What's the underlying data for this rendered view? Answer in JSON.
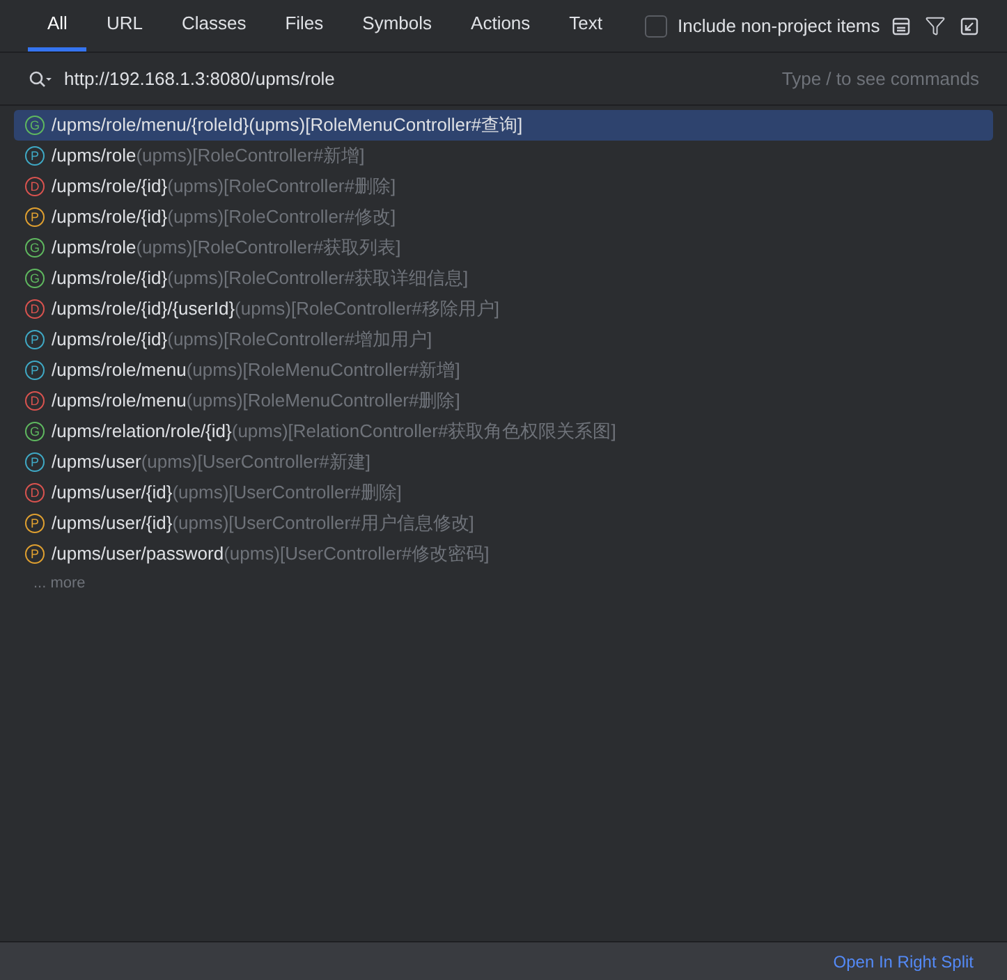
{
  "tabs": [
    {
      "label": "All",
      "selected": true
    },
    {
      "label": "URL",
      "selected": false
    },
    {
      "label": "Classes",
      "selected": false
    },
    {
      "label": "Files",
      "selected": false
    },
    {
      "label": "Symbols",
      "selected": false
    },
    {
      "label": "Actions",
      "selected": false
    },
    {
      "label": "Text",
      "selected": false
    }
  ],
  "include_non_project": {
    "label": "Include non-project items",
    "checked": false
  },
  "search": {
    "value": "http://192.168.1.3:8080/upms/role",
    "hint": "Type / to see commands"
  },
  "results": [
    {
      "badge": "G",
      "color": "#5fb85f",
      "path": "/upms/role/menu/{roleId}",
      "detail": "(upms)[RoleMenuController#查询]",
      "selected": true
    },
    {
      "badge": "P",
      "color": "#3fa9c5",
      "path": "/upms/role",
      "detail": "(upms)[RoleController#新增]",
      "selected": false
    },
    {
      "badge": "D",
      "color": "#d9534f",
      "path": "/upms/role/{id}",
      "detail": "(upms)[RoleController#删除]",
      "selected": false
    },
    {
      "badge": "P",
      "color": "#e0a030",
      "path": "/upms/role/{id}",
      "detail": "(upms)[RoleController#修改]",
      "selected": false
    },
    {
      "badge": "G",
      "color": "#5fb85f",
      "path": "/upms/role",
      "detail": "(upms)[RoleController#获取列表]",
      "selected": false
    },
    {
      "badge": "G",
      "color": "#5fb85f",
      "path": "/upms/role/{id}",
      "detail": "(upms)[RoleController#获取详细信息]",
      "selected": false
    },
    {
      "badge": "D",
      "color": "#d9534f",
      "path": "/upms/role/{id}/{userId}",
      "detail": "(upms)[RoleController#移除用户]",
      "selected": false
    },
    {
      "badge": "P",
      "color": "#3fa9c5",
      "path": "/upms/role/{id}",
      "detail": "(upms)[RoleController#增加用户]",
      "selected": false
    },
    {
      "badge": "P",
      "color": "#3fa9c5",
      "path": "/upms/role/menu",
      "detail": "(upms)[RoleMenuController#新增]",
      "selected": false
    },
    {
      "badge": "D",
      "color": "#d9534f",
      "path": "/upms/role/menu",
      "detail": "(upms)[RoleMenuController#删除]",
      "selected": false
    },
    {
      "badge": "G",
      "color": "#5fb85f",
      "path": "/upms/relation/role/{id}",
      "detail": "(upms)[RelationController#获取角色权限关系图]",
      "selected": false
    },
    {
      "badge": "P",
      "color": "#3fa9c5",
      "path": "/upms/user",
      "detail": "(upms)[UserController#新建]",
      "selected": false
    },
    {
      "badge": "D",
      "color": "#d9534f",
      "path": "/upms/user/{id}",
      "detail": "(upms)[UserController#删除]",
      "selected": false
    },
    {
      "badge": "P",
      "color": "#e0a030",
      "path": "/upms/user/{id}",
      "detail": "(upms)[UserController#用户信息修改]",
      "selected": false
    },
    {
      "badge": "P",
      "color": "#e0a030",
      "path": "/upms/user/password",
      "detail": "(upms)[UserController#修改密码]",
      "selected": false
    }
  ],
  "more": "... more",
  "footer": {
    "link": "Open In Right Split"
  }
}
